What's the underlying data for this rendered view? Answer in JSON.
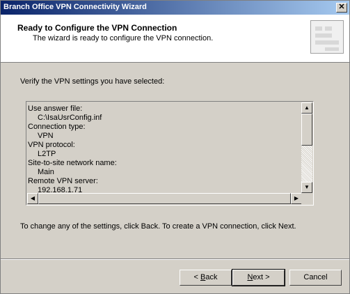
{
  "window": {
    "title": "Branch Office VPN Connectivity Wizard",
    "close_glyph": "✕"
  },
  "header": {
    "title": "Ready to Configure the VPN Connection",
    "subtitle": "The wizard is ready to configure the VPN connection."
  },
  "body": {
    "verify_text": "Verify the VPN settings you have selected:",
    "settings_lines": [
      {
        "text": "Use answer file:",
        "indent": false
      },
      {
        "text": "C:\\IsaUsrConfig.inf",
        "indent": true
      },
      {
        "text": "Connection type:",
        "indent": false
      },
      {
        "text": "VPN",
        "indent": true
      },
      {
        "text": "VPN protocol:",
        "indent": false
      },
      {
        "text": "L2TP",
        "indent": true
      },
      {
        "text": "Site-to-site network name:",
        "indent": false
      },
      {
        "text": "Main",
        "indent": true
      },
      {
        "text": "Remote VPN server:",
        "indent": false
      },
      {
        "text": "192.168.1.71",
        "indent": true
      }
    ],
    "hint_text": "To change any of the settings, click Back. To create a VPN connection, click Next."
  },
  "buttons": {
    "back_prefix": "< ",
    "back_hot": "B",
    "back_rest": "ack",
    "next_hot": "N",
    "next_rest": "ext",
    "next_suffix": " >",
    "cancel": "Cancel"
  }
}
